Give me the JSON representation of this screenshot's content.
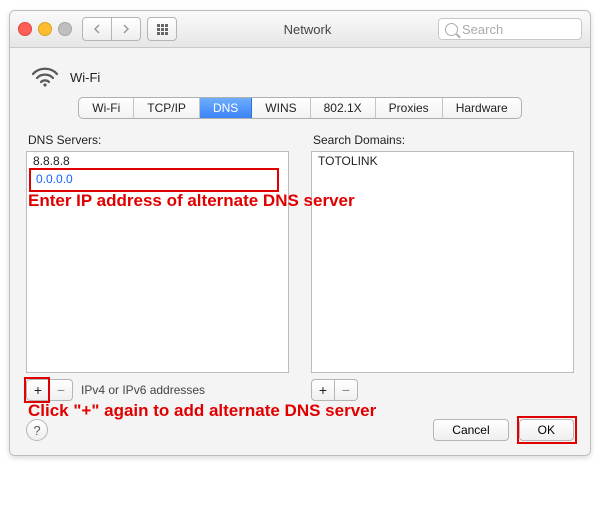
{
  "window": {
    "title": "Network",
    "search_placeholder": "Search"
  },
  "interface": {
    "name": "Wi-Fi",
    "icon": "wifi-icon"
  },
  "tabs": [
    {
      "label": "Wi-Fi"
    },
    {
      "label": "TCP/IP"
    },
    {
      "label": "DNS"
    },
    {
      "label": "WINS"
    },
    {
      "label": "802.1X"
    },
    {
      "label": "Proxies"
    },
    {
      "label": "Hardware"
    }
  ],
  "active_tab": "DNS",
  "dns": {
    "label": "DNS Servers:",
    "servers": [
      "8.8.8.8"
    ],
    "editing": "0.0.0.0",
    "hint": "IPv4 or IPv6 addresses"
  },
  "search_domains": {
    "label": "Search Domains:",
    "items": [
      "TOTOLINK"
    ]
  },
  "buttons": {
    "cancel": "Cancel",
    "ok": "OK",
    "add": "+",
    "remove": "−"
  },
  "annotations": {
    "enter_ip": "Enter IP address of alternate DNS server",
    "click_add": "Click \"+\" again to add alternate DNS server"
  }
}
